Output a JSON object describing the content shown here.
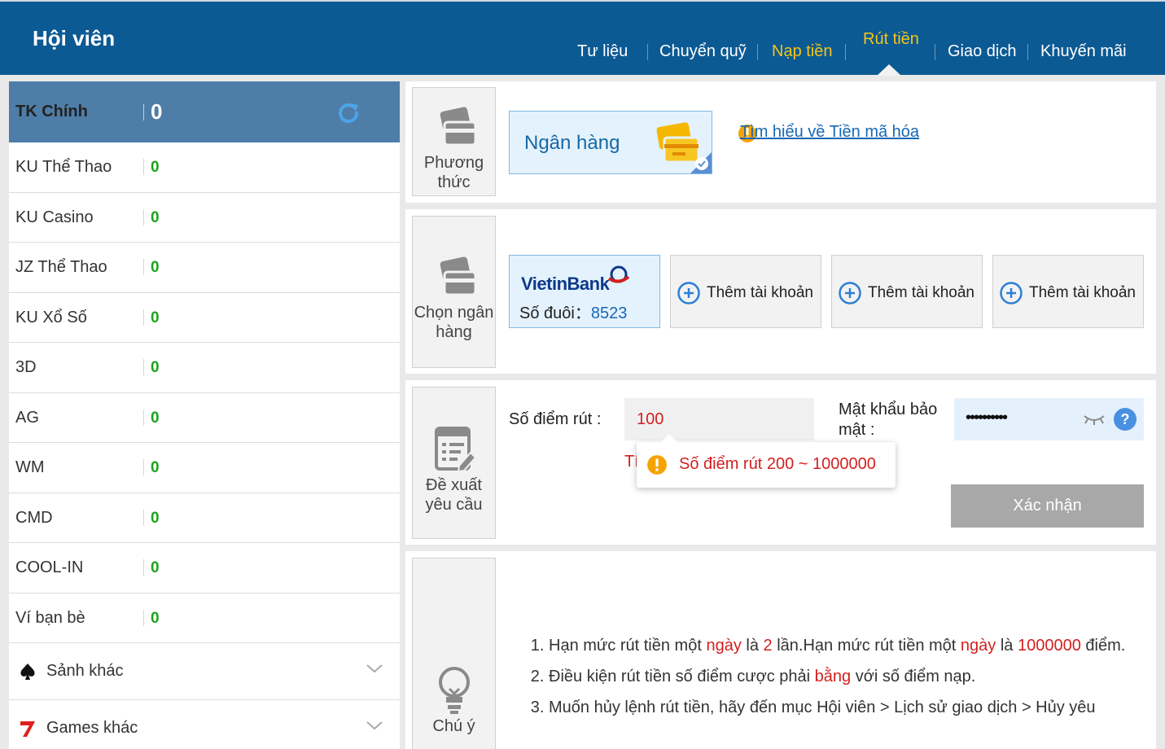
{
  "header": {
    "title": "Hội viên",
    "nav": [
      {
        "label": "Tư liệu"
      },
      {
        "label": "Chuyển quỹ"
      },
      {
        "label": "Nạp tiền"
      },
      {
        "label": "Rút tiền"
      },
      {
        "label": "Giao dịch"
      },
      {
        "label": "Khuyến mãi"
      }
    ],
    "colors": {
      "bar": "#0c5a94",
      "active": "#f5c518"
    }
  },
  "sidebar": {
    "main": {
      "label": "TK Chính",
      "value": "0"
    },
    "accounts": [
      {
        "name": "KU Thể Thao",
        "value": "0"
      },
      {
        "name": "KU Casino",
        "value": "0"
      },
      {
        "name": "JZ Thể Thao",
        "value": "0"
      },
      {
        "name": "KU Xổ Số",
        "value": "0"
      },
      {
        "name": "3D",
        "value": "0"
      },
      {
        "name": "AG",
        "value": "0"
      },
      {
        "name": "WM",
        "value": "0"
      },
      {
        "name": "CMD",
        "value": "0"
      },
      {
        "name": "COOL-IN",
        "value": "0"
      },
      {
        "name": "Ví bạn bè",
        "value": "0"
      }
    ],
    "groups": [
      {
        "name": "Sảnh khác",
        "icon": "spade-icon"
      },
      {
        "name": "Games khác",
        "icon": "seven-icon"
      }
    ]
  },
  "method": {
    "tag": "Phương thức",
    "option": "Ngân hàng",
    "info_link": "Tìm hiểu về Tiền mã hóa"
  },
  "bank": {
    "tag": "Chọn ngân hàng",
    "selected": {
      "logo_text": "VietinBank",
      "suffix_label": "Số đuôi：",
      "suffix_value": "8523"
    },
    "add_label": "Thêm tài khoản"
  },
  "form": {
    "tag": "Đề xuất yêu cầu",
    "amount_label": "Số điểm rút :",
    "amount_value": "100",
    "password_label": "Mật khẩu bảo mật :",
    "password_value": "••••••••••",
    "tooltip": "Số điểm rút 200 ~ 1000000",
    "hidden_hint_prefix": "Tí",
    "confirm": "Xác nhận"
  },
  "notes": {
    "tag": "Chú ý",
    "n1": {
      "a": "Hạn mức rút tiền một ",
      "b": "ngày",
      "c": " là ",
      "d": "2",
      "e": " lần.Hạn mức rút tiền một ",
      "f": "ngày",
      "g": " là ",
      "h": "1000000",
      "i": " điểm."
    },
    "n2": {
      "a": "Điều kiện rút tiền số điểm cược phải ",
      "b": "bằng",
      "c": " với số điểm nạp."
    },
    "n3": "Muốn hủy lệnh rút tiền, hãy đến mục Hội viên > Lịch sử giao dịch > Hủy yêu"
  }
}
